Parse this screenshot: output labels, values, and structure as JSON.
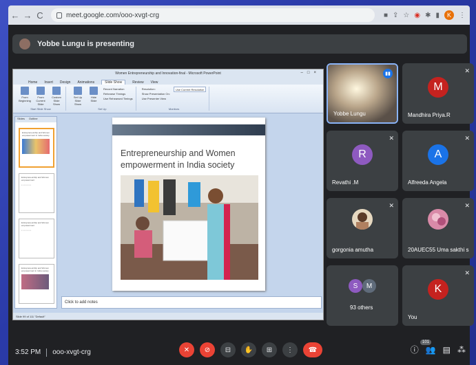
{
  "browser": {
    "url": "meet.google.com/ooo-xvgt-crg",
    "avatar_letter": "K"
  },
  "presenting_banner": "Yobbe Lungu is presenting",
  "ppt": {
    "window_title": "Women Entrepreneurship and Innovation-final - Microsoft PowerPoint",
    "tabs": [
      "Home",
      "Insert",
      "Design",
      "Animations",
      "Slide Show",
      "Review",
      "View"
    ],
    "active_tab": "Slide Show",
    "ribbon": {
      "start_group": [
        "From Beginning",
        "From Current Slide",
        "Custom Slide Show"
      ],
      "start_label": "Start Slide Show",
      "setup_group": [
        "Set Up Slide Show",
        "Hide Slide"
      ],
      "setup_list": [
        "Record Narration",
        "Rehearse Timings",
        "Use Rehearsed Timings"
      ],
      "setup_label": "Set Up",
      "monitors_list": [
        "Resolution:",
        "Show Presentation On:",
        "Use Presenter View"
      ],
      "resolution_value": "Use Current Resolution",
      "monitors_label": "Monitors"
    },
    "panel_tabs": [
      "Slides",
      "Outline"
    ],
    "thumbs": [
      "Entrepreneurship and Women empowerment in India society",
      "Entrepreneurship and Women empowerment",
      "Entrepreneurship and Women empowerment",
      "Entrepreneurship and Women empowerment in India society"
    ],
    "slide_title": "Entrepreneurship and Women empowerment in India society",
    "notes_placeholder": "Click to add notes",
    "status": "Slide 99 of 111   \"Default\""
  },
  "tiles": [
    {
      "name": "Yobbe Lungu",
      "speaking": true
    },
    {
      "name": "Mandhira Priya.R",
      "letter": "M",
      "color": "#c5221f"
    },
    {
      "name": "Revathi .M",
      "letter": "R",
      "color": "#8e5ac0"
    },
    {
      "name": "Alfreeda Angela",
      "letter": "A",
      "color": "#1a73e8"
    },
    {
      "name": "gorgonia amutha"
    },
    {
      "name": "20AUEC55 Uma sakthi s"
    },
    {
      "name": "93 others",
      "letters": [
        "S",
        "M"
      ]
    },
    {
      "name": "You",
      "letter": "K",
      "color": "#c5221f"
    }
  ],
  "bottom": {
    "time": "3:52 PM",
    "meeting_code": "ooo-xvgt-crg",
    "participant_count": "101"
  },
  "colors": {
    "meet_bg": "#202124",
    "tile_bg": "#3c4043",
    "end_call": "#ea4335",
    "speaking": "#1a73e8"
  }
}
